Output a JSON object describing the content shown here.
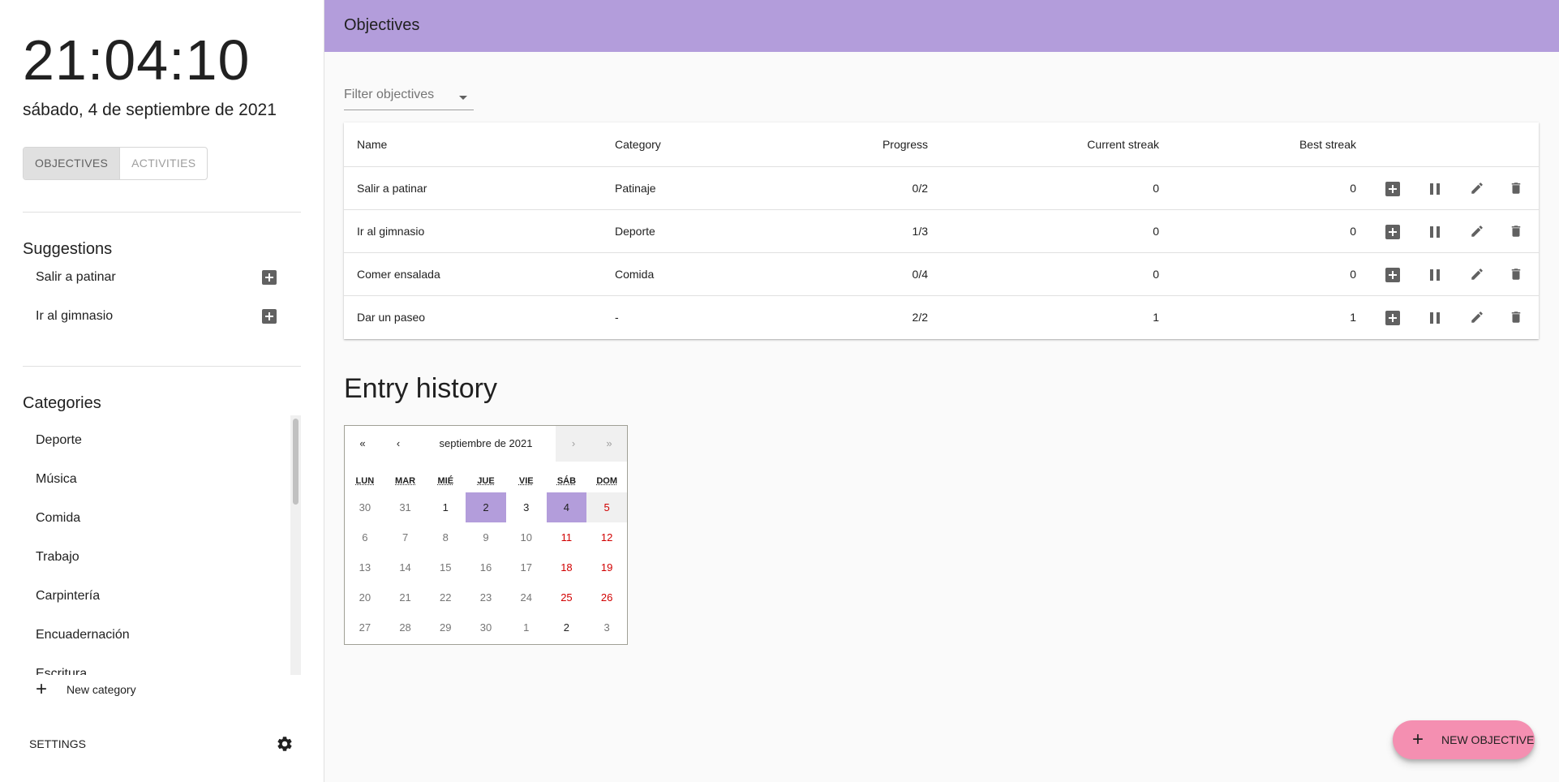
{
  "sidebar": {
    "clock": "21:04:10",
    "date": "sábado, 4 de septiembre de 2021",
    "toggle": [
      "Objectives",
      "Activities"
    ],
    "suggestions_title": "Suggestions",
    "suggestions": [
      "Salir a patinar",
      "Ir al gimnasio"
    ],
    "categories_title": "Categories",
    "categories": [
      "Deporte",
      "Música",
      "Comida",
      "Trabajo",
      "Carpintería",
      "Encuadernación",
      "Escritura"
    ],
    "new_category": "New category",
    "settings": "Settings"
  },
  "header": {
    "title": "Objectives"
  },
  "filter": {
    "placeholder": "Filter objectives"
  },
  "table": {
    "columns": [
      "Name",
      "Category",
      "Progress",
      "Current streak",
      "Best streak"
    ],
    "rows": [
      {
        "name": "Salir a patinar",
        "category": "Patinaje",
        "progress": "0/2",
        "current": "0",
        "best": "0"
      },
      {
        "name": "Ir al gimnasio",
        "category": "Deporte",
        "progress": "1/3",
        "current": "0",
        "best": "0"
      },
      {
        "name": "Comer ensalada",
        "category": "Comida",
        "progress": "0/4",
        "current": "0",
        "best": "0"
      },
      {
        "name": "Dar un paseo",
        "category": "-",
        "progress": "2/2",
        "current": "1",
        "best": "1"
      }
    ]
  },
  "history": {
    "title": "Entry history",
    "calendar": {
      "month_label": "septiembre de 2021",
      "nav": {
        "first": "«",
        "prev": "‹",
        "next": "›",
        "last": "»"
      },
      "weekdays": [
        "LUN",
        "MAR",
        "MIÉ",
        "JUE",
        "VIE",
        "SÁB",
        "DOM"
      ],
      "weeks": [
        [
          "30",
          "31",
          "1",
          "2",
          "3",
          "4",
          "5"
        ],
        [
          "6",
          "7",
          "8",
          "9",
          "10",
          "11",
          "12"
        ],
        [
          "13",
          "14",
          "15",
          "16",
          "17",
          "18",
          "19"
        ],
        [
          "20",
          "21",
          "22",
          "23",
          "24",
          "25",
          "26"
        ],
        [
          "27",
          "28",
          "29",
          "30",
          "1",
          "2",
          "3"
        ]
      ]
    }
  },
  "fab": {
    "label": "New objective"
  },
  "colors": {
    "accent": "#b39ddb",
    "fab": "#f48fb1",
    "weekend": "#d10000"
  }
}
